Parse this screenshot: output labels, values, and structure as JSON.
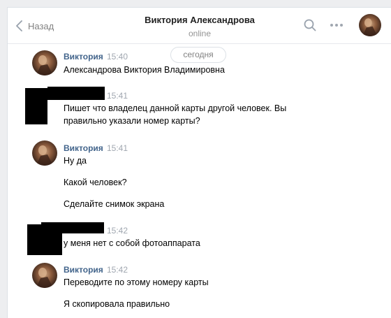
{
  "header": {
    "back_label": "Назад",
    "title": "Виктория Александрова",
    "status": "online"
  },
  "date_separator": "сегодня",
  "messages": [
    {
      "author": "Виктория",
      "time": "15:40",
      "lines": [
        "Александрова Виктория Владимировна"
      ]
    },
    {
      "author": "",
      "time": "15:41",
      "lines": [
        "Пишет что владелец данной карты другой человек. Вы",
        "правильно указали номер карты?"
      ]
    },
    {
      "author": "Виктория",
      "time": "15:41",
      "lines": [
        "Ну да",
        "Какой человек?",
        "Сделайте снимок экрана"
      ]
    },
    {
      "author": "",
      "time": "15:42",
      "lines": [
        "у меня нет с собой фотоаппарата"
      ]
    },
    {
      "author": "Виктория",
      "time": "15:42",
      "lines": [
        "Переводите по этому номеру карты",
        "Я скопировала правильно"
      ]
    }
  ],
  "icons": {
    "back": "chevron-left-icon",
    "search": "search-icon",
    "more": "more-icon"
  },
  "colors": {
    "name": "#42648b",
    "meta": "#a0a7b0",
    "background": "#edeef0"
  }
}
